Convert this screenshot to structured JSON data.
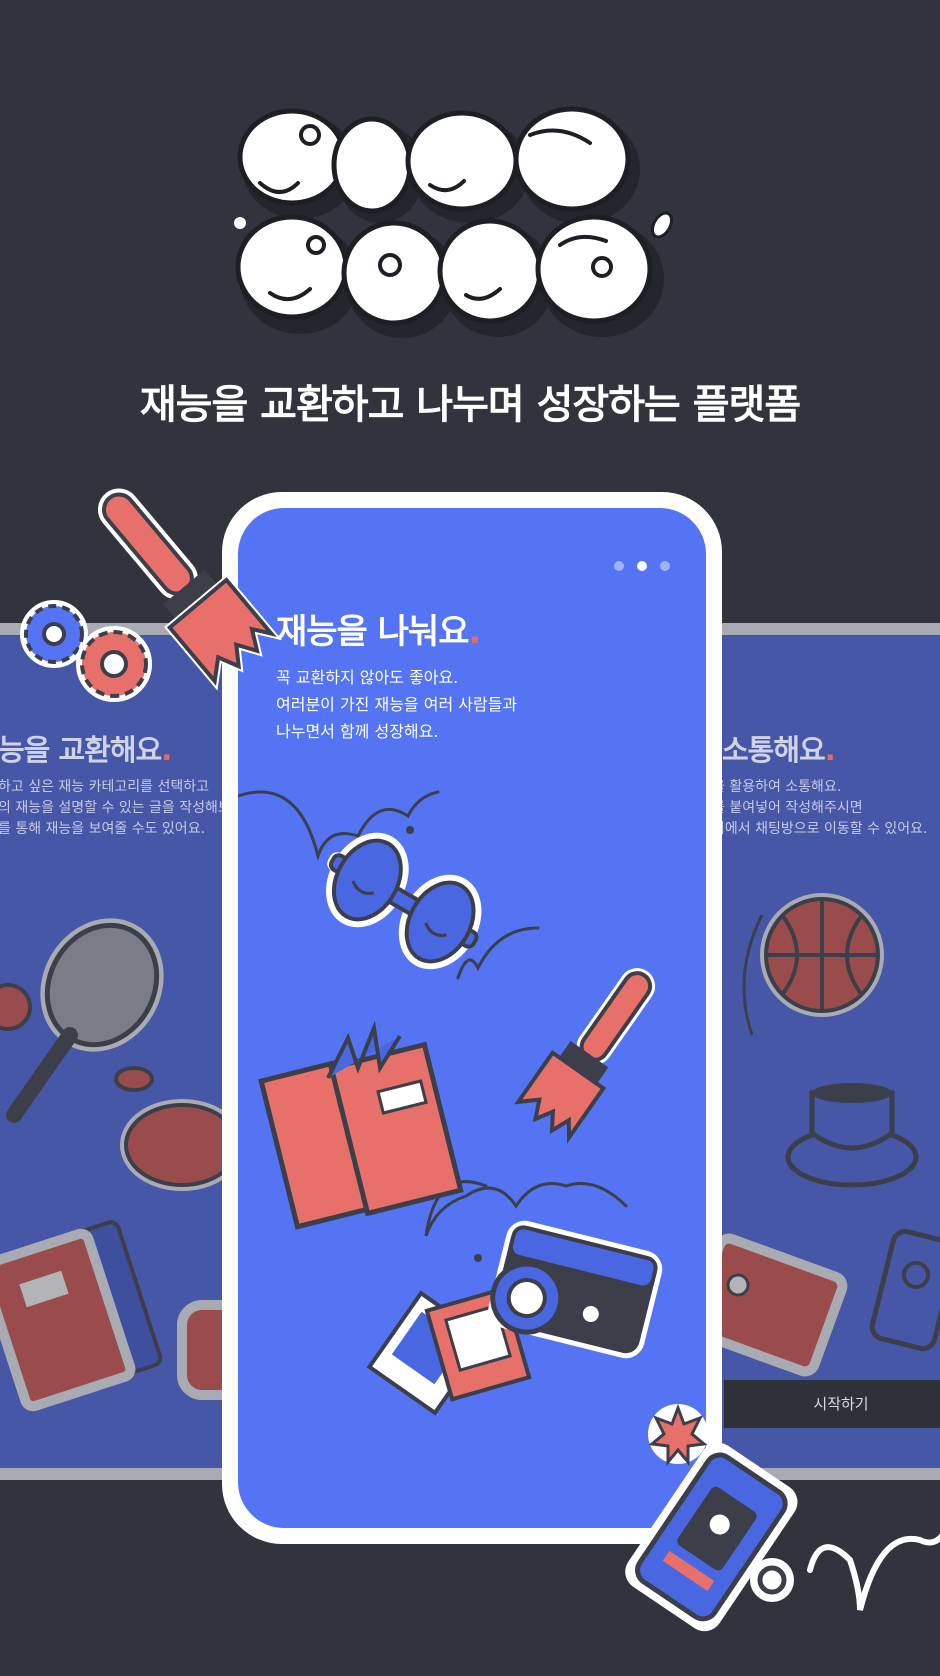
{
  "tagline": "재능을 교환하고 나누며 성장하는 플랫폼",
  "left_screen": {
    "title": "능을 교환해요",
    "title_dot": ".",
    "lines": [
      "하고 싶은 재능 카테고리를 선택하고",
      "의 재능을 설명할 수 있는 글을 작성해보세요",
      "를 통해 재능을 보여줄 수도 있어요."
    ]
  },
  "main_screen": {
    "title": "재능을 나눠요",
    "title_dot": ".",
    "lines": [
      "꼭 교환하지 않아도 좋아요.",
      "여러분이 가진 재능을 여러 사람들과",
      "나누면서 함께 성장해요."
    ],
    "pages": 3,
    "active_page": 2
  },
  "right_screen": {
    "title": "소통해요",
    "title_dot": ".",
    "lines": [
      "을 활용하여 소통해요.",
      "를 붙여넣어 작성해주시면",
      "지에서 채팅방으로 이동할 수 있어요."
    ],
    "start_button": "시작하기"
  },
  "colors": {
    "background": "#31343d",
    "phone_screen": "#5474f3",
    "side_screen": "#4657a8",
    "accent_red": "#e8706a",
    "outline": "#3c3f4a"
  },
  "icons": [
    "paintbrush-icon",
    "gear-icon",
    "dumbbell-icon",
    "book-icon",
    "camera-icon",
    "photo-icon",
    "smartphone-icon",
    "tennis-racket-icon",
    "basketball-icon",
    "coffee-cup-icon"
  ]
}
